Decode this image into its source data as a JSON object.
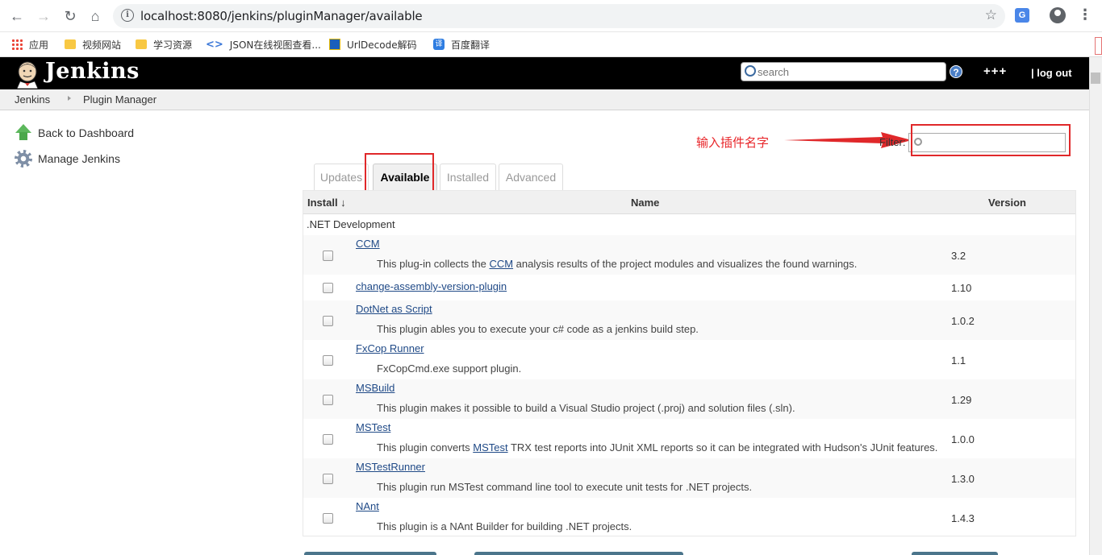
{
  "browser": {
    "url": "localhost:8080/jenkins/pluginManager/available",
    "bookmarks": [
      {
        "label": "应用",
        "icon": "apps-icon"
      },
      {
        "label": "视频网站",
        "icon": "folder-icon"
      },
      {
        "label": "学习资源",
        "icon": "folder-icon"
      },
      {
        "label": "JSON在线视图查看...",
        "icon": "json-icon"
      },
      {
        "label": "UrlDecode解码",
        "icon": "urldecode-icon"
      },
      {
        "label": "百度翻译",
        "icon": "baidu-translate-icon"
      }
    ],
    "baidu_icon_text": "译",
    "json_icon_text": "<>",
    "translate_icon_text": "G"
  },
  "header": {
    "logo_text": "Jenkins",
    "search_placeholder": "search",
    "help": "?",
    "user": "+++",
    "logout": "| log out"
  },
  "breadcrumb": [
    "Jenkins",
    "Plugin Manager"
  ],
  "side_panel": {
    "back": "Back to Dashboard",
    "manage": "Manage Jenkins"
  },
  "annotation": {
    "text": "输入插件名字",
    "color": "#e0282a"
  },
  "filter": {
    "label": "Filter:",
    "value": ""
  },
  "tabs": [
    {
      "label": "Updates",
      "active": false
    },
    {
      "label": "Available",
      "active": true
    },
    {
      "label": "Installed",
      "active": false
    },
    {
      "label": "Advanced",
      "active": false
    }
  ],
  "table": {
    "headers": {
      "install": "Install ↓",
      "name": "Name",
      "version": "Version"
    },
    "category": ".NET Development",
    "plugins": [
      {
        "name": "CCM",
        "desc_before": "This plug-in collects the ",
        "desc_link": "CCM",
        "desc_after": " analysis results of the project modules and visualizes the found warnings.",
        "version": "3.2"
      },
      {
        "name": "change-assembly-version-plugin",
        "desc_before": "",
        "desc_link": "",
        "desc_after": "",
        "version": "1.10"
      },
      {
        "name": "DotNet as Script",
        "desc_before": "This plugin ables you to execute your c# code as a jenkins build step.",
        "desc_link": "",
        "desc_after": "",
        "version": "1.0.2"
      },
      {
        "name": "FxCop Runner",
        "desc_before": "FxCopCmd.exe support plugin.",
        "desc_link": "",
        "desc_after": "",
        "version": "1.1"
      },
      {
        "name": "MSBuild",
        "desc_before": "This plugin makes it possible to build a Visual Studio project (.proj) and solution files (.sln).",
        "desc_link": "",
        "desc_after": "",
        "version": "1.29"
      },
      {
        "name": "MSTest",
        "desc_before": "This plugin converts ",
        "desc_link": "MSTest",
        "desc_after": " TRX test reports into JUnit XML reports so it can be integrated with Hudson's JUnit features.",
        "version": "1.0.0"
      },
      {
        "name": "MSTestRunner",
        "desc_before": "This plugin run MSTest command line tool to execute unit tests for .NET projects.",
        "desc_link": "",
        "desc_after": "",
        "version": "1.3.0"
      },
      {
        "name": "NAnt",
        "desc_before": "This plugin is a NAnt Builder for building .NET projects.",
        "desc_link": "",
        "desc_after": "",
        "version": "1.4.3"
      }
    ]
  }
}
